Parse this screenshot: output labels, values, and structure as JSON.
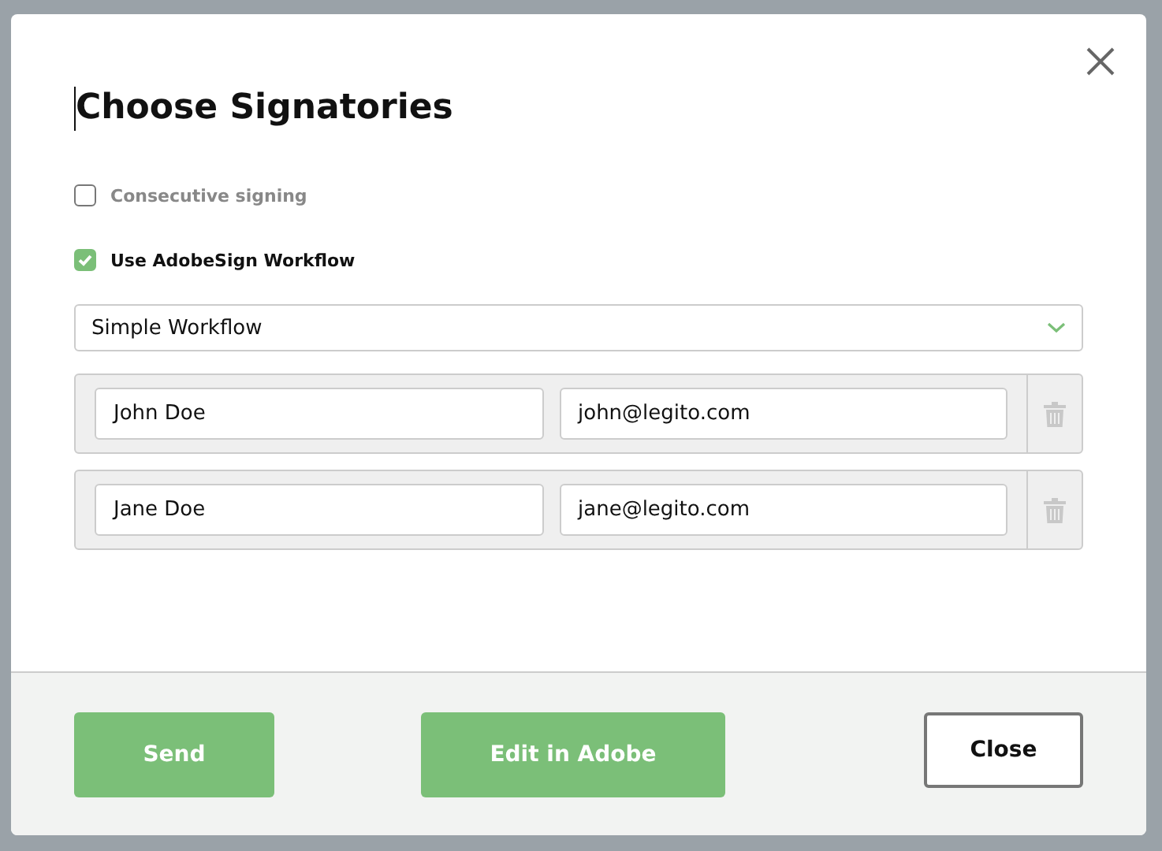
{
  "dialog": {
    "title": "Choose Signatories"
  },
  "options": [
    {
      "label": "Consecutive signing",
      "checked": false
    },
    {
      "label": "Use AdobeSign Workflow",
      "checked": true
    }
  ],
  "workflow_select": {
    "value": "Simple Workflow"
  },
  "signatories": [
    {
      "name": "John Doe",
      "email": "john@legito.com"
    },
    {
      "name": "Jane Doe",
      "email": "jane@legito.com"
    }
  ],
  "buttons": [
    {
      "label": "Send",
      "kind": "primary"
    },
    {
      "label": "Edit in Adobe",
      "kind": "primary"
    },
    {
      "label": "Close",
      "kind": "secondary"
    }
  ]
}
